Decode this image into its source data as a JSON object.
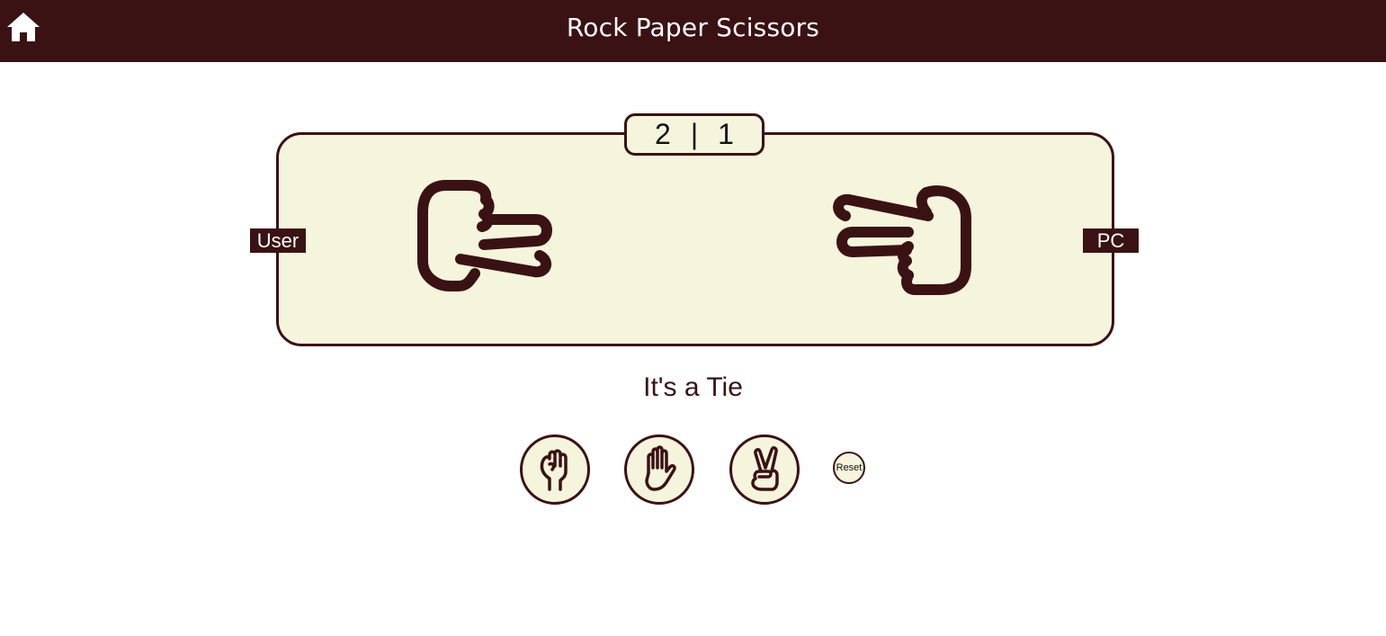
{
  "header": {
    "title": "Rock Paper Scissors",
    "home_icon": "home-icon"
  },
  "scoreboard": {
    "user_score": "2",
    "separator": "|",
    "pc_score": "1"
  },
  "players": {
    "user_label": "User",
    "pc_label": "PC",
    "user_choice_icon": "scissors-hand-icon",
    "pc_choice_icon": "scissors-hand-icon"
  },
  "result": {
    "text": "It's a Tie"
  },
  "choices": [
    {
      "name": "rock",
      "icon": "rock-hand-icon"
    },
    {
      "name": "paper",
      "icon": "paper-hand-icon"
    },
    {
      "name": "scissors",
      "icon": "scissors-hand-icon"
    }
  ],
  "reset": {
    "label": "Reset"
  },
  "colors": {
    "primary": "#3a1214",
    "board_background": "#f5f4dc",
    "page_background": "#ffffff"
  }
}
